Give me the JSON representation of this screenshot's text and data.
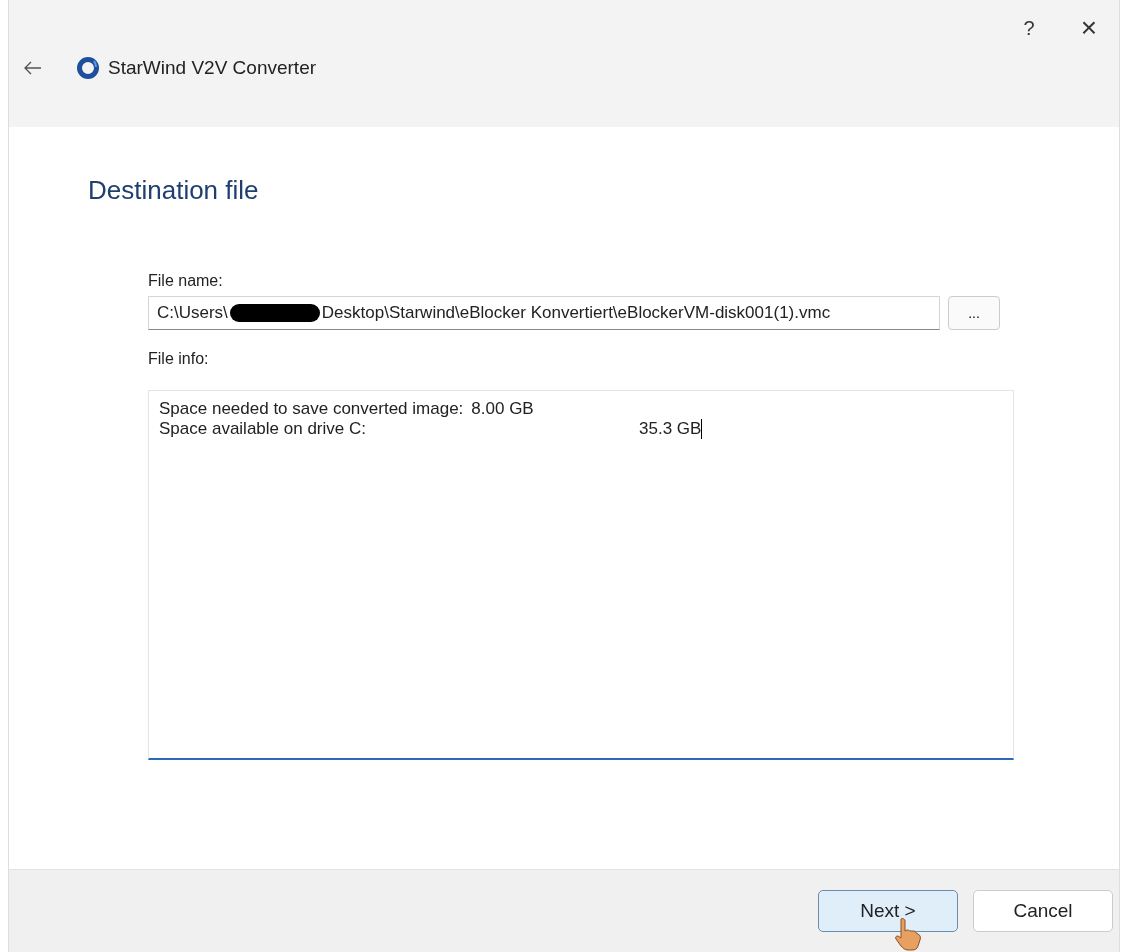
{
  "title_bar": {
    "help": "?",
    "close": "×"
  },
  "header": {
    "title": "StarWind V2V Converter"
  },
  "page": {
    "heading": "Destination file"
  },
  "file_name": {
    "label": "File name:",
    "value_parts": [
      "C:\\Users\\",
      "Desktop\\Starwind\\eBlocker Konvertiert\\eBlockerVM-disk001(1).vmc"
    ],
    "redacted": true,
    "browse": "..."
  },
  "file_info": {
    "label": "File info:",
    "lines": [
      {
        "label": "Space needed to save converted image:",
        "value": "8.00 GB"
      },
      {
        "label": "Space available on drive C:",
        "value": "35.3 GB"
      }
    ]
  },
  "buttons": [
    {
      "label": "Next >",
      "kind": "primary",
      "hovered": true
    },
    {
      "label": "Cancel",
      "kind": "secondary",
      "hovered": false
    }
  ]
}
